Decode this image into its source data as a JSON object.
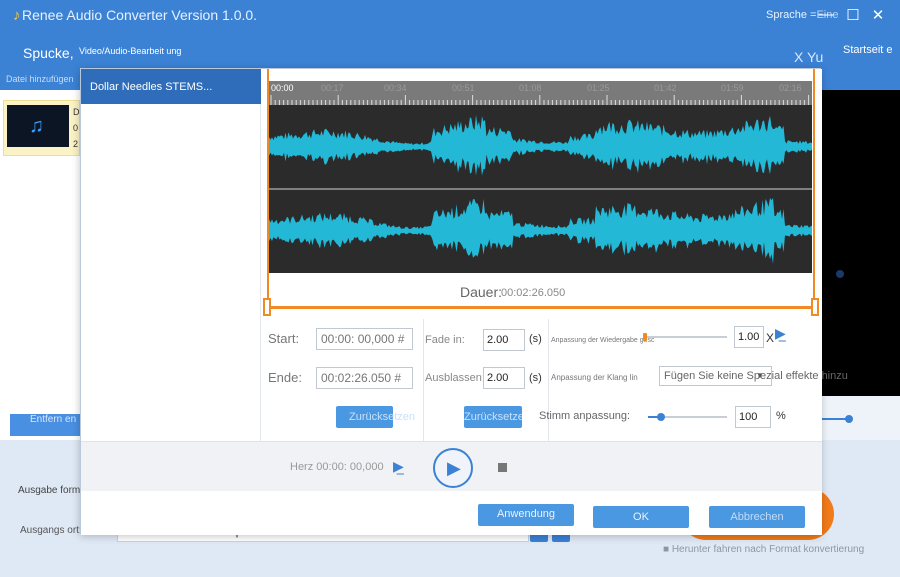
{
  "window": {
    "title": "Renee Audio Converter Version 1.0.0.",
    "language_label": "Sprache =",
    "language_value": "Eine",
    "min_glyph": "—",
    "max_glyph": "☐",
    "close_glyph": "✕"
  },
  "toolbar": {
    "spucke": "Spucke,",
    "video_audio": "Video/Audio-Bearbeit ung",
    "x_yu": "X Yu",
    "start": "Startseit e"
  },
  "subbar": {
    "add_file": "Datei hinzufügen"
  },
  "file": {
    "line1": "D",
    "line2": "0",
    "line3": "2"
  },
  "left": {
    "remove": "Entfern en"
  },
  "bottom": {
    "output_format": "Ausgabe form at:",
    "output_dir": "Ausgangs ort:",
    "path": "C:\\Users\\KE-de\\Desktop",
    "shutdown": "■ Herunter fahren nach Format konvertierung"
  },
  "dialog": {
    "list_item": "Dollar Needles STEMS...",
    "ruler_start": "00:00",
    "ruler_ticks": [
      "00:17",
      "00:34",
      "00:51",
      "01:08",
      "01:25",
      "01:42",
      "01:59",
      "02:16"
    ],
    "duration_label": "Dauer:",
    "duration_value": "00:02:26.050",
    "start_label": "Start:",
    "start_value": "00:00: 00,000 #",
    "end_label": "Ende:",
    "end_value": "00:02:26.050 #",
    "reset_left": "Zurücksetzen",
    "fade_in_label": "Fade in:",
    "fade_in_value": "2.00",
    "fade_out_label": "Ausblassen:",
    "fade_out_value": "2.00",
    "seconds_unit": "(s)",
    "reset_mid": "Zurücksetzen",
    "speed_label": "Anpassung der Wiedergabe gesc",
    "speed_value": "1.00",
    "speed_unit": "X",
    "tone_label": "Anpassung der Klang lin",
    "effect_placeholder": "Fügen Sie keine Spezial effekte hinzu",
    "voice_label": "Stimm anpassung:",
    "voice_value": "100",
    "voice_unit": "%",
    "herz": "Herz 00:00: 00,000",
    "apply": "Anwendung",
    "ok": "OK",
    "cancel": "Abbrechen"
  },
  "colors": {
    "titlebar": "#3b82d4",
    "waveform": "#22b8d6",
    "trim": "#f08a24",
    "accent": "#4a97e2"
  }
}
